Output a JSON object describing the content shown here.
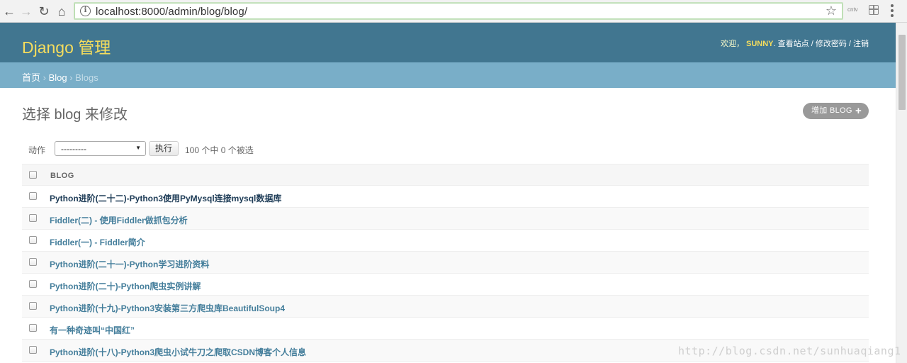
{
  "browser": {
    "url": "localhost:8000/admin/blog/blog/",
    "extension_label": "cntv"
  },
  "header": {
    "brand": "Django 管理",
    "welcome": "欢迎，",
    "username": "SUNNY",
    "view_site": "查看站点",
    "change_password": "修改密码",
    "logout": "注销",
    "separator": " / "
  },
  "breadcrumbs": {
    "home": "首页",
    "app": "Blog",
    "model": "Blogs",
    "sep": " › "
  },
  "content": {
    "title": "选择 blog 来修改",
    "add_button": "增加 BLOG",
    "action_label": "动作",
    "action_select": "---------",
    "go_button": "执行",
    "selection_count": "100 个中 0 个被选",
    "column_header": "BLOG",
    "rows": [
      "Python进阶(二十二)-Python3使用PyMysql连接mysql数据库",
      "Fiddler(二) - 使用Fiddler做抓包分析",
      "Fiddler(一) - Fiddler简介",
      "Python进阶(二十一)-Python学习进阶资料",
      "Python进阶(二十)-Python爬虫实例讲解",
      "Python进阶(十九)-Python3安装第三方爬虫库BeautifulSoup4",
      "有一种奇迹叫“中国红”",
      "Python进阶(十八)-Python3爬虫小试牛刀之爬取CSDN博客个人信息"
    ]
  },
  "watermark": "http://blog.csdn.net/sunhuaqiang1",
  "colors": {
    "header_bg": "#417690",
    "breadcrumb_bg": "#79aec8",
    "brand_yellow": "#f5dd5d",
    "link_blue": "#447e9b"
  }
}
